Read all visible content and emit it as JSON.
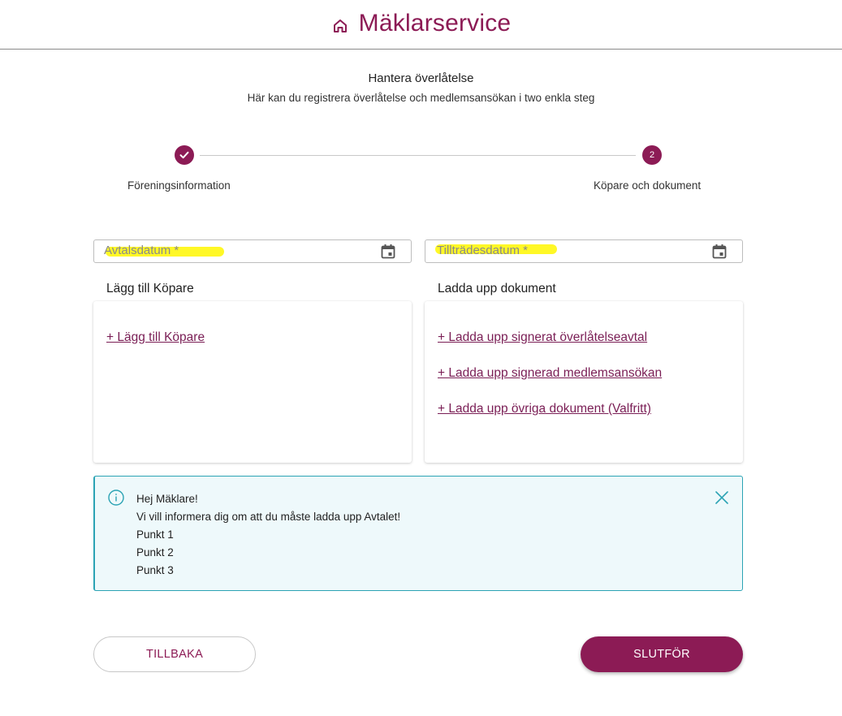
{
  "header": {
    "title": "Mäklarservice",
    "icon": "home-icon",
    "brand_color": "#8c1b55"
  },
  "intro": {
    "title": "Hantera överlåtelse",
    "subtitle": "Här kan du registrera överlåtelse och medlemsansökan i two enkla steg"
  },
  "stepper": {
    "steps": [
      {
        "label": "Föreningsinformation",
        "state": "completed",
        "marker": "check-icon"
      },
      {
        "label": "Köpare och dokument",
        "state": "active",
        "marker": "2"
      }
    ]
  },
  "fields": {
    "agreement_date": {
      "placeholder": "Avtalsdatum *",
      "icon": "calendar-icon"
    },
    "access_date": {
      "placeholder": "Tillträdesdatum *",
      "icon": "calendar-icon"
    }
  },
  "buyers": {
    "title": "Lägg till Köpare",
    "add_link": "+ Lägg till Köpare"
  },
  "documents": {
    "title": "Ladda upp dokument",
    "links": [
      "+ Ladda upp signerat överlåtelseavtal",
      "+ Ladda upp signerad medlemsansökan",
      "+ Ladda upp övriga dokument (Valfritt)"
    ]
  },
  "info": {
    "lines": [
      "Hej Mäklare!",
      "Vi vill informera dig om att du måste ladda upp Avtalet!",
      "Punkt 1",
      "Punkt 2",
      "Punkt 3"
    ],
    "accent_color": "#2ba3b4"
  },
  "actions": {
    "back_label": "TILLBAKA",
    "finish_label": "SLUTFÖR"
  }
}
